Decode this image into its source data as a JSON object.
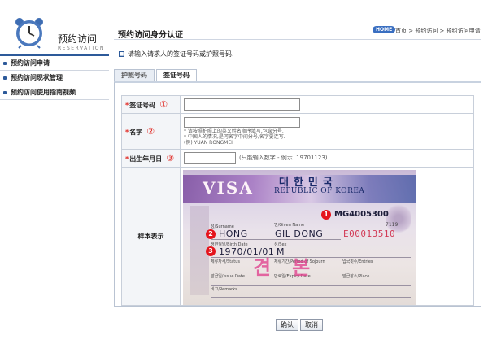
{
  "sidebar": {
    "title": "预约访问",
    "subtitle": "RESERVATION",
    "items": [
      {
        "label": "预约访问申请"
      },
      {
        "label": "预约访问现状管理"
      },
      {
        "label": "预约访问使用指南视频"
      }
    ]
  },
  "header": {
    "title": "预约访问身分认证",
    "home_badge": "HOME",
    "breadcrumb": "首页 > 预约访问 > 预约访问申请"
  },
  "notice": "请输入请求人的签证号码或护照号码.",
  "tabs": [
    {
      "label": "护照号码",
      "active": false
    },
    {
      "label": "签证号码",
      "active": true
    }
  ],
  "form": {
    "visa_no": {
      "label": "签证号码",
      "marker": "①",
      "value": ""
    },
    "name": {
      "label": "名字",
      "marker": "②",
      "value": "",
      "hint1": "* 请按照护照上的英文姓名顺序填写,包含分号.",
      "hint2": "* 中国人的情况,是河名字中间分号,名字要连写.",
      "hint3": "(例) YUAN RONGMEI"
    },
    "birth": {
      "label": "出生年月日",
      "marker": "③",
      "value": "",
      "hint": "(只能输入数字 - 例示. 19701123)"
    },
    "sample_label": "样本表示"
  },
  "visa_sample": {
    "visa_word": "VISA",
    "korean_title": "대한민국",
    "country": "REPUBLIC OF KOREA",
    "passport_no": "MG4005300",
    "small_no": "7119",
    "surname_label": "성/Surname",
    "given_label": "명/Given Name",
    "surname": "HONG",
    "given_name": "GIL DONG",
    "dob_label": "생년월일/Birth Date",
    "sex_label": "성/Sex",
    "dob": "1970/01/01",
    "sex": "M",
    "serial": "E00013510",
    "status_label": "체류자격/Status",
    "sojourn_label": "체류기간/Period of Sojourn",
    "entries_label": "입국횟수/Entries",
    "issue_label": "발급일/Issue Date",
    "expiry_label": "만료일/Expiry Date",
    "place_label": "발급장소/Place",
    "remarks_label": "비고/Remarks",
    "stamp": "견본",
    "markers": [
      "1",
      "2",
      "3"
    ]
  },
  "buttons": {
    "confirm": "确认",
    "cancel": "取消"
  },
  "colors": {
    "accent": "#2d5a9a",
    "required": "#e0251f",
    "home_badge": "#3a6fc1"
  }
}
